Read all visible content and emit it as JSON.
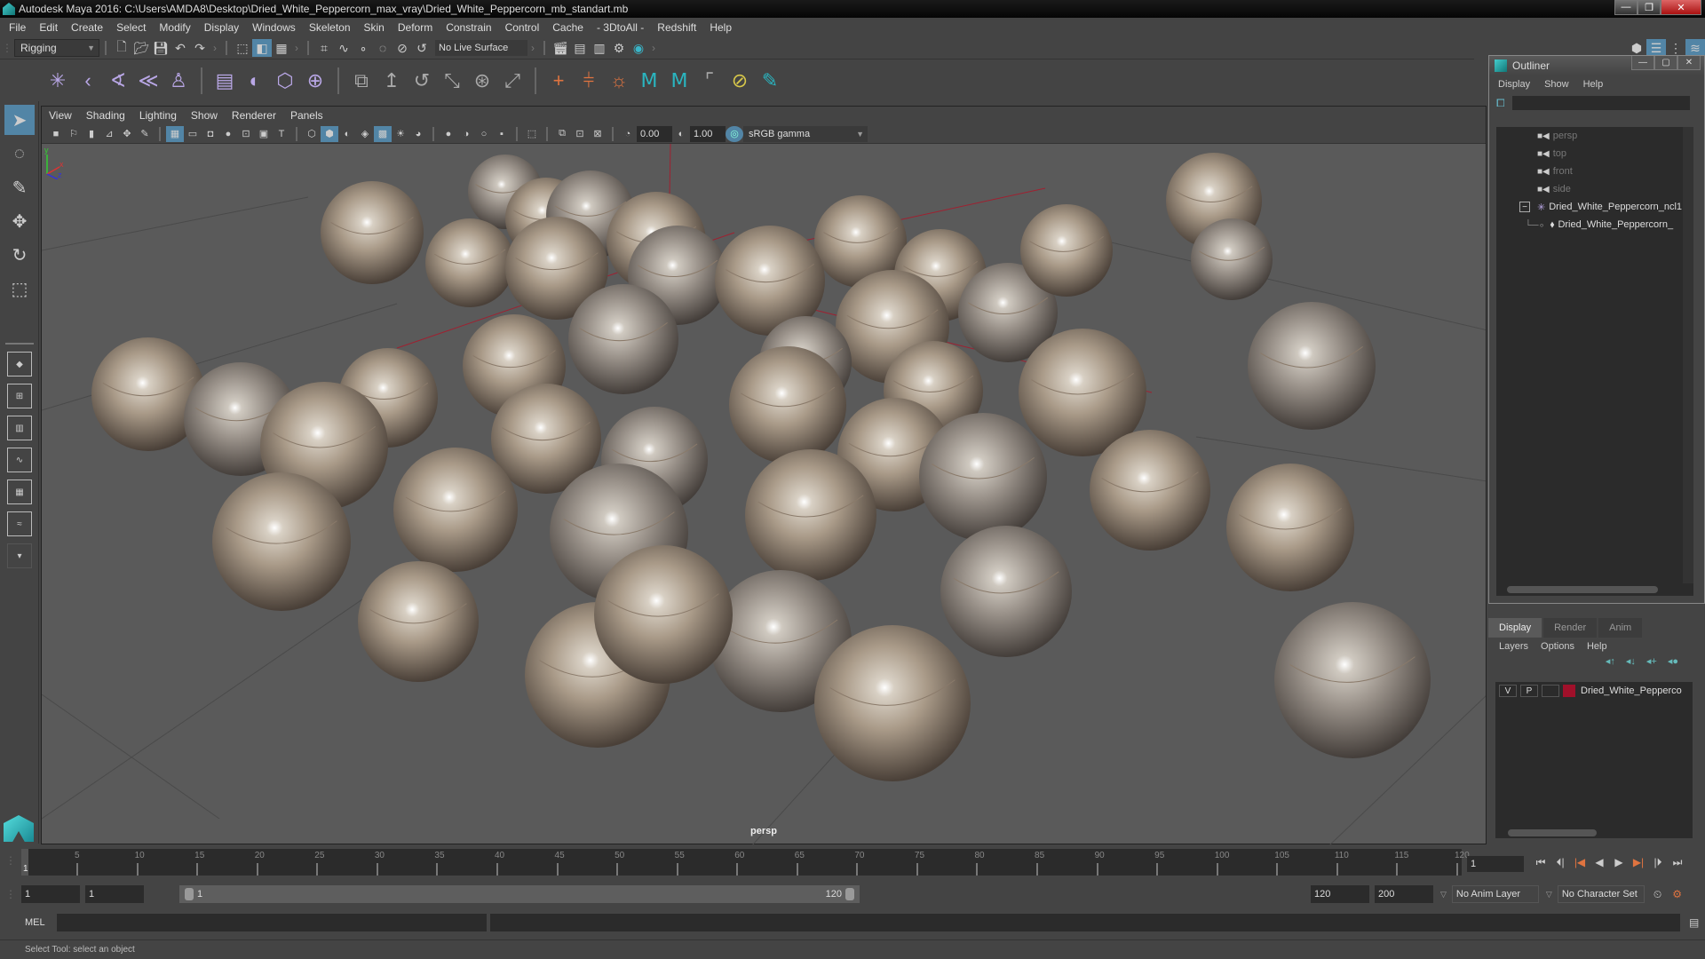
{
  "window": {
    "title": "Autodesk Maya 2016: C:\\Users\\AMDA8\\Desktop\\Dried_White_Peppercorn_max_vray\\Dried_White_Peppercorn_mb_standart.mb",
    "minimize": "—",
    "maximize": "❐",
    "close": "✕"
  },
  "menubar": [
    "File",
    "Edit",
    "Create",
    "Select",
    "Modify",
    "Display",
    "Windows",
    "Skeleton",
    "Skin",
    "Deform",
    "Constrain",
    "Control",
    "Cache",
    "- 3DtoAll -",
    "Redshift",
    "Help"
  ],
  "statusline": {
    "menuset": "Rigging",
    "live_surface": "No Live Surface",
    "icons": [
      "new-scene",
      "open-scene",
      "save-scene",
      "undo",
      "redo",
      "select-by-hierarchy",
      "select-by-object",
      "select-by-component",
      "snap-grid",
      "snap-curve",
      "snap-point",
      "snap-view-plane",
      "snap-live",
      "make-live",
      "render-view",
      "render-current",
      "ipr-render",
      "render-settings",
      "hypershade"
    ]
  },
  "shelf": {
    "icons": [
      {
        "name": "joint-tool",
        "glyph": "✳",
        "color": "purple"
      },
      {
        "name": "ik-handle",
        "glyph": "‹",
        "color": "purple"
      },
      {
        "name": "ik-spline",
        "glyph": "∢",
        "color": "purple"
      },
      {
        "name": "insert-joint",
        "glyph": "≪",
        "color": "purple"
      },
      {
        "name": "humanik",
        "glyph": "♙",
        "color": "purple"
      },
      {
        "name": "skin-bind",
        "glyph": "▤",
        "color": "purple"
      },
      {
        "name": "paint-weights",
        "glyph": "◐",
        "color": "purple"
      },
      {
        "name": "lattice",
        "glyph": "⬡",
        "color": "purple"
      },
      {
        "name": "cluster",
        "glyph": "⊕",
        "color": "purple"
      },
      {
        "name": "parent-constraint",
        "glyph": "⧉",
        "color": "gray"
      },
      {
        "name": "point-constraint",
        "glyph": "↥",
        "color": "gray"
      },
      {
        "name": "orient-constraint",
        "glyph": "↺",
        "color": "gray"
      },
      {
        "name": "scale-constraint",
        "glyph": "⤡",
        "color": "gray"
      },
      {
        "name": "aim-constraint",
        "glyph": "⊛",
        "color": "gray"
      },
      {
        "name": "pole-vector",
        "glyph": "⤢",
        "color": "gray"
      },
      {
        "name": "locator",
        "glyph": "+",
        "color": "orange"
      },
      {
        "name": "locator-constraint",
        "glyph": "⫩",
        "color": "orange"
      },
      {
        "name": "character-run",
        "glyph": "☼",
        "color": "orange"
      },
      {
        "name": "maya-m-1",
        "glyph": "Ⅿ",
        "color": "teal"
      },
      {
        "name": "maya-m-2",
        "glyph": "Ⅿ",
        "color": "teal"
      },
      {
        "name": "empty-slot",
        "glyph": "⌜",
        "color": "gray"
      },
      {
        "name": "layers-off",
        "glyph": "⊘",
        "color": "yellow"
      },
      {
        "name": "paint-select",
        "glyph": "✎",
        "color": "teal"
      }
    ]
  },
  "viewport": {
    "menu": [
      "View",
      "Shading",
      "Lighting",
      "Show",
      "Renderer",
      "Panels"
    ],
    "exposure": "0.00",
    "gamma": "1.00",
    "color_space": "sRGB gamma",
    "camera_label": "persp"
  },
  "toolbox": [
    "select-tool",
    "lasso-tool",
    "paint-select-tool",
    "move-tool",
    "rotate-tool",
    "scale-tool"
  ],
  "outliner": {
    "title": "Outliner",
    "menu": [
      "Display",
      "Show",
      "Help"
    ],
    "cameras": [
      "persp",
      "top",
      "front",
      "side"
    ],
    "group": "Dried_White_Peppercorn_ncl1",
    "child": "Dried_White_Peppercorn_"
  },
  "layer_editor": {
    "tabs": [
      "Display",
      "Render",
      "Anim"
    ],
    "active_tab": "Display",
    "menu": [
      "Layers",
      "Options",
      "Help"
    ],
    "layer": {
      "v": "V",
      "p": "P",
      "name": "Dried_White_Pepperco",
      "color": "#a0102a"
    }
  },
  "timeline": {
    "ticks": [
      5,
      10,
      15,
      20,
      25,
      30,
      35,
      40,
      45,
      50,
      55,
      60,
      65,
      70,
      75,
      80,
      85,
      90,
      95,
      100,
      105,
      110,
      115,
      120
    ],
    "start": 1,
    "end": 120,
    "current_frame": "1",
    "current_label": "1"
  },
  "range": {
    "start_field": "1",
    "anim_start_field": "1",
    "slider_start": "1",
    "slider_end": "120",
    "end_field": "120",
    "anim_end_field": "200",
    "anim_layer": "No Anim Layer",
    "character_set": "No Character Set"
  },
  "command": {
    "label": "MEL"
  },
  "help_line": "Select Tool: select an object"
}
